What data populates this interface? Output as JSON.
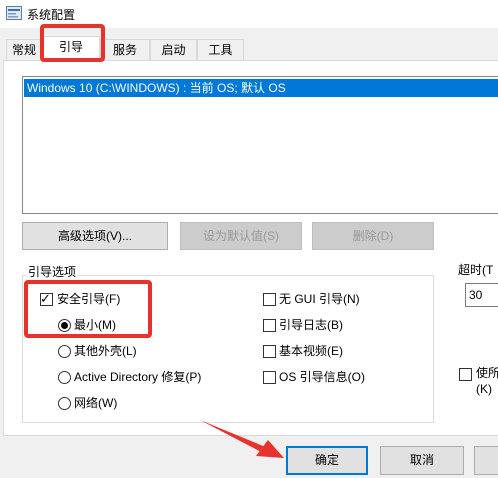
{
  "window": {
    "title": "系统配置",
    "icon": "msconfig-app-icon"
  },
  "tabs": [
    {
      "label": "常规"
    },
    {
      "label": "引导",
      "active": true
    },
    {
      "label": "服务"
    },
    {
      "label": "启动"
    },
    {
      "label": "工具"
    }
  ],
  "os_list": {
    "items": [
      {
        "label": "Windows 10 (C:\\WINDOWS) : 当前 OS; 默认 OS",
        "selected": true
      }
    ]
  },
  "buttons": {
    "advanced": "高级选项(V)...",
    "set_default": "设为默认值(S)",
    "delete": "删除(D)"
  },
  "boot_options": {
    "title": "引导选项",
    "safe_boot": {
      "label": "安全引导(F)",
      "checked": true
    },
    "minimal": {
      "label": "最小(M)",
      "selected": true
    },
    "alternate_shell": {
      "label": "其他外壳(L)",
      "selected": false
    },
    "active_directory": {
      "label": "Active Directory 修复(P)",
      "selected": false
    },
    "network": {
      "label": "网络(W)",
      "selected": false
    },
    "no_gui_boot": {
      "label": "无 GUI 引导(N)",
      "checked": false
    },
    "boot_log": {
      "label": "引导日志(B)",
      "checked": false
    },
    "base_video": {
      "label": "基本视频(E)",
      "checked": false
    },
    "os_boot_info": {
      "label": "OS 引导信息(O)",
      "checked": false
    }
  },
  "timeout": {
    "label": "超时(T",
    "value": "30"
  },
  "make_permanent": {
    "label_line1": "使所",
    "label_line2": "(K)",
    "checked": false
  },
  "footer": {
    "ok": "确定",
    "cancel": "取消"
  },
  "annotations": {
    "highlight_color": "#e8322d"
  },
  "colors": {
    "selection": "#0078d7",
    "accent_border": "#0078d7"
  }
}
